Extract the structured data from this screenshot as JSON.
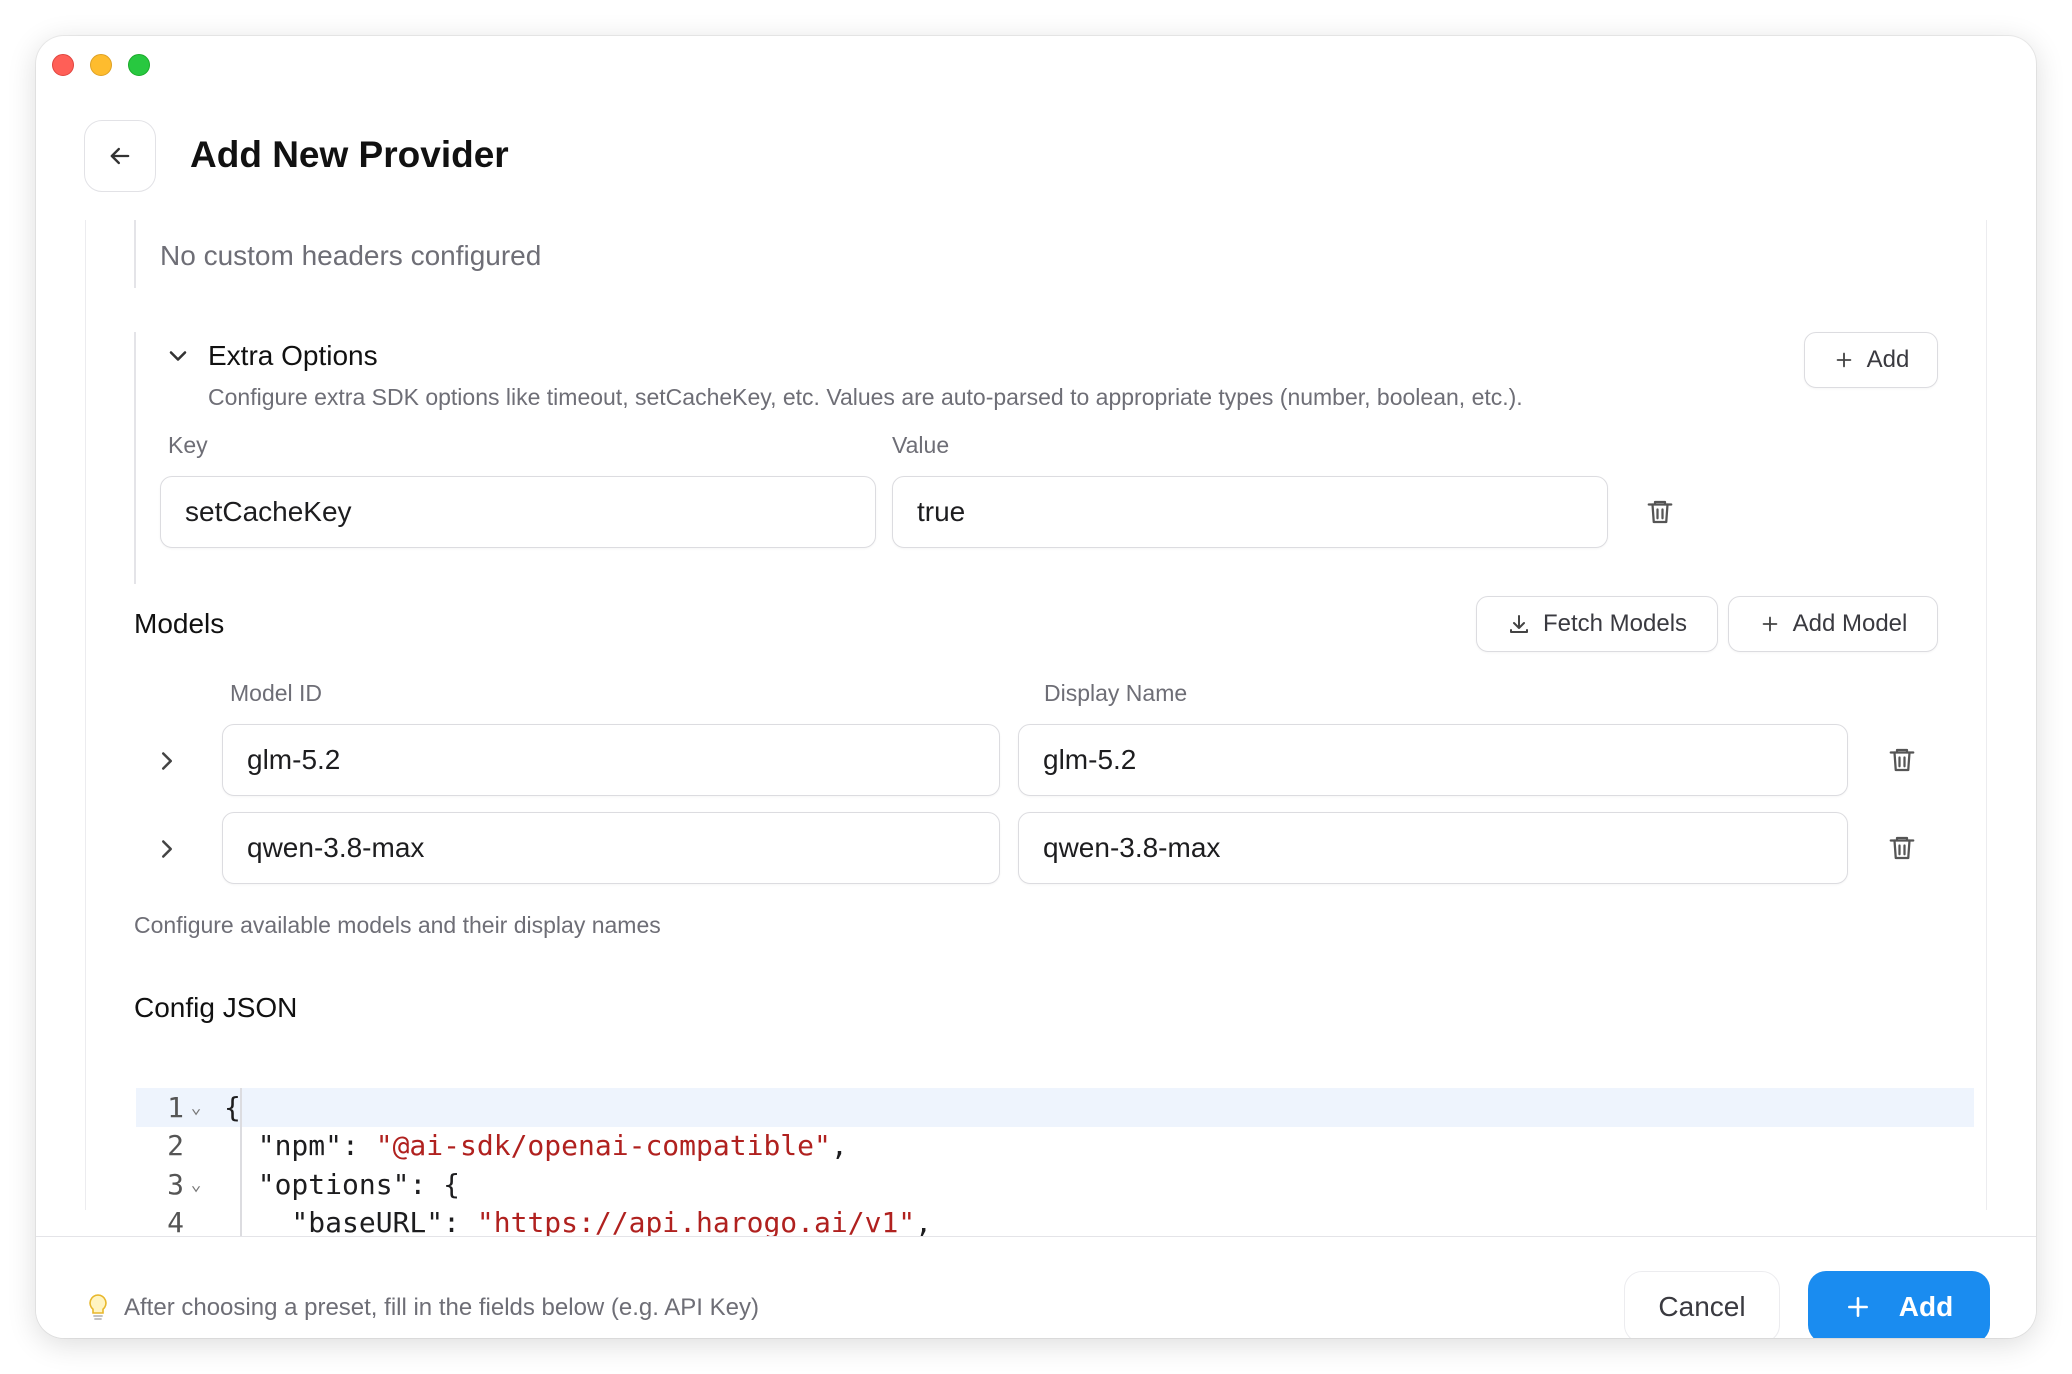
{
  "window": {
    "title": "Add New Provider"
  },
  "headers": {
    "empty_text": "No custom headers configured"
  },
  "extra_options": {
    "title": "Extra Options",
    "description": "Configure extra SDK options like timeout, setCacheKey, etc. Values are auto-parsed to appropriate types (number, boolean, etc.).",
    "add_label": "Add",
    "key_label": "Key",
    "value_label": "Value",
    "rows": [
      {
        "key": "setCacheKey",
        "value": "true"
      }
    ]
  },
  "models": {
    "title": "Models",
    "fetch_label": "Fetch Models",
    "add_label": "Add Model",
    "col_model_id": "Model ID",
    "col_display_name": "Display Name",
    "rows": [
      {
        "model_id": "glm-5.2",
        "display_name": "glm-5.2"
      },
      {
        "model_id": "qwen-3.8-max",
        "display_name": "qwen-3.8-max"
      }
    ],
    "help": "Configure available models and their display names"
  },
  "config_json": {
    "title": "Config JSON",
    "lines": [
      {
        "n": "1",
        "fold": true,
        "parts": [
          {
            "t": "{",
            "s": false
          }
        ]
      },
      {
        "n": "2",
        "fold": false,
        "parts": [
          {
            "t": "  \"npm\": ",
            "s": false
          },
          {
            "t": "\"@ai-sdk/openai-compatible\"",
            "s": true
          },
          {
            "t": ",",
            "s": false
          }
        ]
      },
      {
        "n": "3",
        "fold": true,
        "parts": [
          {
            "t": "  \"options\": {",
            "s": false
          }
        ]
      },
      {
        "n": "4",
        "fold": false,
        "parts": [
          {
            "t": "    \"baseURL\": ",
            "s": false
          },
          {
            "t": "\"https://api.harogo.ai/v1\"",
            "s": true
          },
          {
            "t": ",",
            "s": false
          }
        ]
      }
    ]
  },
  "footer": {
    "hint": "After choosing a preset, fill in the fields below (e.g. API Key)",
    "cancel_label": "Cancel",
    "add_label": "Add"
  },
  "colors": {
    "accent": "#1a8cf0",
    "string": "#b0211f",
    "active_line": "#eef4fd"
  }
}
